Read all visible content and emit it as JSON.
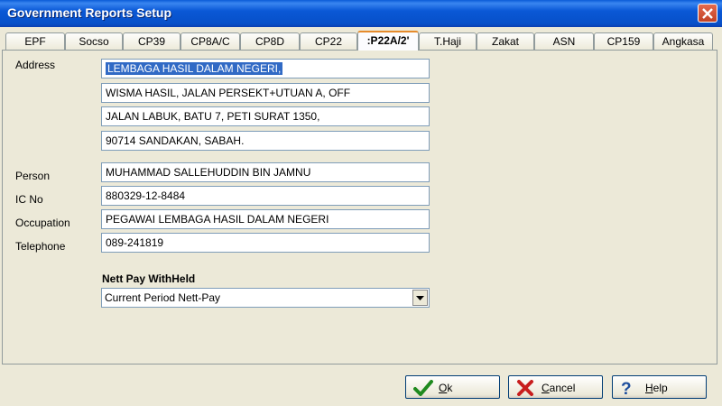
{
  "window": {
    "title": "Government Reports Setup",
    "close_icon": "close-icon"
  },
  "tabs": [
    {
      "label": "EPF"
    },
    {
      "label": "Socso"
    },
    {
      "label": "CP39"
    },
    {
      "label": "CP8A/C"
    },
    {
      "label": "CP8D"
    },
    {
      "label": "CP22"
    },
    {
      "label": ":P22A/2'",
      "active": true
    },
    {
      "label": "T.Haji"
    },
    {
      "label": "Zakat"
    },
    {
      "label": "ASN"
    },
    {
      "label": "CP159"
    },
    {
      "label": "Angkasa"
    }
  ],
  "form": {
    "address_label": "Address",
    "address_lines": [
      "LEMBAGA HASIL DALAM NEGERI,",
      "WISMA HASIL, JALAN PERSEKT+UTUAN A, OFF",
      "JALAN LABUK, BATU 7, PETI SURAT 1350,",
      "90714 SANDAKAN, SABAH."
    ],
    "person_label": "Person",
    "person_value": "MUHAMMAD SALLEHUDDIN BIN JAMNU",
    "icno_label": "IC No",
    "icno_value": "880329-12-8484",
    "occupation_label": "Occupation",
    "occupation_value": "PEGAWAI  LEMBAGA HASIL DALAM NEGERI",
    "telephone_label": "Telephone",
    "telephone_value": "089-241819",
    "nett_pay_label": "Nett Pay WithHeld",
    "nett_pay_value": "Current Period Nett-Pay"
  },
  "buttons": {
    "ok": {
      "label_first": "O",
      "label_rest": "k"
    },
    "cancel": {
      "label_first": "C",
      "label_rest": "ancel"
    },
    "help": {
      "label_first": "H",
      "label_rest": "elp"
    }
  },
  "colors": {
    "title_bar": "#0a58d6",
    "selection": "#316ac5",
    "dialog": "#ece9d8",
    "active_tab_accent": "#e68b2c"
  }
}
